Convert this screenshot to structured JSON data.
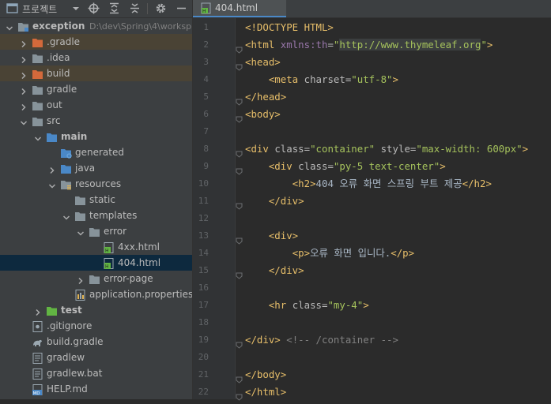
{
  "project_panel": {
    "title": "프로젝트",
    "tree": [
      {
        "label": "exception",
        "path": "D:\\dev\\Spring\\4\\worksp",
        "level": 0,
        "expanded": true,
        "icon": "module-folder",
        "bold": true
      },
      {
        "label": ".gradle",
        "level": 1,
        "expanded": false,
        "icon": "excluded-folder",
        "highlight": true
      },
      {
        "label": ".idea",
        "level": 1,
        "expanded": false,
        "icon": "folder"
      },
      {
        "label": "build",
        "level": 1,
        "expanded": false,
        "icon": "excluded-folder",
        "highlight": true
      },
      {
        "label": "gradle",
        "level": 1,
        "expanded": false,
        "icon": "folder"
      },
      {
        "label": "out",
        "level": 1,
        "expanded": false,
        "icon": "folder"
      },
      {
        "label": "src",
        "level": 1,
        "expanded": true,
        "icon": "folder"
      },
      {
        "label": "main",
        "level": 2,
        "expanded": true,
        "icon": "source-root-folder",
        "bold": true
      },
      {
        "label": "generated",
        "level": 3,
        "expanded": null,
        "icon": "generated-folder"
      },
      {
        "label": "java",
        "level": 3,
        "expanded": false,
        "icon": "source-folder"
      },
      {
        "label": "resources",
        "level": 3,
        "expanded": true,
        "icon": "resources-folder"
      },
      {
        "label": "static",
        "level": 4,
        "expanded": null,
        "icon": "folder"
      },
      {
        "label": "templates",
        "level": 4,
        "expanded": true,
        "icon": "folder"
      },
      {
        "label": "error",
        "level": 5,
        "expanded": true,
        "icon": "folder"
      },
      {
        "label": "4xx.html",
        "level": 6,
        "expanded": null,
        "icon": "html-file"
      },
      {
        "label": "404.html",
        "level": 6,
        "expanded": null,
        "icon": "html-file",
        "selected": true
      },
      {
        "label": "error-page",
        "level": 5,
        "expanded": false,
        "icon": "folder"
      },
      {
        "label": "application.properties",
        "level": 4,
        "expanded": null,
        "icon": "properties-file"
      },
      {
        "label": "test",
        "level": 2,
        "expanded": false,
        "icon": "test-folder",
        "bold": true
      },
      {
        "label": ".gitignore",
        "level": 1,
        "expanded": null,
        "icon": "gitignore-file"
      },
      {
        "label": "build.gradle",
        "level": 1,
        "expanded": null,
        "icon": "gradle-file"
      },
      {
        "label": "gradlew",
        "level": 1,
        "expanded": null,
        "icon": "text-file"
      },
      {
        "label": "gradlew.bat",
        "level": 1,
        "expanded": null,
        "icon": "text-file"
      },
      {
        "label": "HELP.md",
        "level": 1,
        "expanded": null,
        "icon": "markdown-file"
      }
    ]
  },
  "editor": {
    "tab_label": "404.html",
    "line_numbers": [
      "1",
      "2",
      "3",
      "4",
      "5",
      "6",
      "7",
      "8",
      "9",
      "10",
      "11",
      "12",
      "13",
      "14",
      "15",
      "16",
      "17",
      "18",
      "19",
      "20",
      "21",
      "22"
    ],
    "lines": [
      {
        "n": "1",
        "fold": false,
        "tokens": [
          [
            "tag",
            "<!DOCTYPE HTML>"
          ]
        ]
      },
      {
        "n": "2",
        "fold": true,
        "tokens": [
          [
            "tag",
            "<html "
          ],
          [
            "ns",
            "xmlns:th"
          ],
          [
            "attr",
            "="
          ],
          [
            "val",
            "\""
          ],
          [
            "url",
            "http://www.thymeleaf.org"
          ],
          [
            "val",
            "\""
          ],
          [
            "tag",
            ">"
          ]
        ]
      },
      {
        "n": "3",
        "fold": true,
        "tokens": [
          [
            "tag",
            "<head>"
          ]
        ]
      },
      {
        "n": "4",
        "fold": false,
        "tokens": [
          [
            "text",
            "    "
          ],
          [
            "tag",
            "<meta "
          ],
          [
            "attr",
            "charset="
          ],
          [
            "val",
            "\"utf-8\""
          ],
          [
            "tag",
            ">"
          ]
        ]
      },
      {
        "n": "5",
        "fold": true,
        "tokens": [
          [
            "tag",
            "</head>"
          ]
        ]
      },
      {
        "n": "6",
        "fold": true,
        "tokens": [
          [
            "tag",
            "<body>"
          ]
        ]
      },
      {
        "n": "7",
        "fold": false,
        "tokens": []
      },
      {
        "n": "8",
        "fold": true,
        "tokens": [
          [
            "tag",
            "<div "
          ],
          [
            "attr",
            "class="
          ],
          [
            "val",
            "\"container\""
          ],
          [
            "attr",
            " style="
          ],
          [
            "val",
            "\"max-width: 600px\""
          ],
          [
            "tag",
            ">"
          ]
        ]
      },
      {
        "n": "9",
        "fold": true,
        "tokens": [
          [
            "text",
            "    "
          ],
          [
            "tag",
            "<div "
          ],
          [
            "attr",
            "class="
          ],
          [
            "val",
            "\"py-5 text-center\""
          ],
          [
            "tag",
            ">"
          ]
        ]
      },
      {
        "n": "10",
        "fold": false,
        "tokens": [
          [
            "text",
            "        "
          ],
          [
            "tag",
            "<h2>"
          ],
          [
            "text",
            "404 오류 화면 스프링 부트 제공"
          ],
          [
            "tag",
            "</h2>"
          ]
        ]
      },
      {
        "n": "11",
        "fold": true,
        "tokens": [
          [
            "text",
            "    "
          ],
          [
            "tag",
            "</div>"
          ]
        ]
      },
      {
        "n": "12",
        "fold": false,
        "tokens": []
      },
      {
        "n": "13",
        "fold": true,
        "tokens": [
          [
            "text",
            "    "
          ],
          [
            "tag",
            "<div>"
          ]
        ]
      },
      {
        "n": "14",
        "fold": false,
        "tokens": [
          [
            "text",
            "        "
          ],
          [
            "tag",
            "<p>"
          ],
          [
            "text",
            "오류 화면 입니다."
          ],
          [
            "tag",
            "</p>"
          ]
        ]
      },
      {
        "n": "15",
        "fold": true,
        "tokens": [
          [
            "text",
            "    "
          ],
          [
            "tag",
            "</div>"
          ]
        ]
      },
      {
        "n": "16",
        "fold": false,
        "tokens": []
      },
      {
        "n": "17",
        "fold": false,
        "tokens": [
          [
            "text",
            "    "
          ],
          [
            "tag",
            "<hr "
          ],
          [
            "attr",
            "class="
          ],
          [
            "val",
            "\"my-4\""
          ],
          [
            "tag",
            ">"
          ]
        ]
      },
      {
        "n": "18",
        "fold": false,
        "tokens": []
      },
      {
        "n": "19",
        "fold": true,
        "tokens": [
          [
            "tag",
            "</div>"
          ],
          [
            "text",
            " "
          ],
          [
            "com",
            "<!-- /container -->"
          ]
        ]
      },
      {
        "n": "20",
        "fold": false,
        "tokens": []
      },
      {
        "n": "21",
        "fold": true,
        "tokens": [
          [
            "tag",
            "</body>"
          ]
        ]
      },
      {
        "n": "22",
        "fold": true,
        "tokens": [
          [
            "tag",
            "</html>"
          ]
        ]
      }
    ]
  },
  "colors": {
    "tag": "#e8bf6a",
    "attr": "#bababa",
    "value": "#a5c25c",
    "selection": "#0d293e",
    "excluded_highlight": "#4a4335"
  }
}
